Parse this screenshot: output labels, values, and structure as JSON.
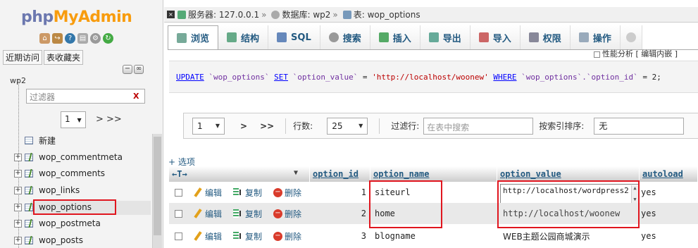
{
  "nav": {
    "logo_part1": "php",
    "logo_part2": "MyAdmin",
    "tabs": [
      "近期访问",
      "表收藏夹"
    ],
    "db_name": "wp2",
    "filter_placeholder": "过滤器",
    "page_value": "1",
    "page_arrows": "> >>",
    "new_label": "新建",
    "tables": [
      "wop_commentmeta",
      "wop_comments",
      "wop_links",
      "wop_options",
      "wop_postmeta",
      "wop_posts"
    ]
  },
  "breadcrumb": {
    "server_label": "服务器: 127.0.0.1",
    "db_label": "数据库: wp2",
    "table_label": "表: wop_options"
  },
  "tabs": [
    "浏览",
    "结构",
    "SQL",
    "搜索",
    "插入",
    "导出",
    "导入",
    "权限",
    "操作"
  ],
  "profiling_label": "性能分析 [ 编辑内嵌 ]",
  "sql": {
    "kw1": "UPDATE",
    "t1": "`wop_options`",
    "kw2": "SET",
    "t2": "`option_value`",
    "eq": " = ",
    "val": "'http://localhost/woonew'",
    "kw3": "WHERE",
    "t3": "`wop_options`.`option_id`",
    "tail": " = 2;"
  },
  "pager": {
    "page": "1",
    "next": ">",
    "last": ">>",
    "rows_label": "行数:",
    "rows_value": "25",
    "filter_label": "过滤行:",
    "filter_placeholder": "在表中搜索",
    "sort_label": "按索引排序:",
    "sort_value": "无"
  },
  "options_link": "+ 选项",
  "table": {
    "headers": [
      "option_id",
      "option_name",
      "option_value",
      "autoload"
    ],
    "actions": {
      "edit": "编辑",
      "copy": "复制",
      "delete": "删除"
    },
    "rows": [
      {
        "option_id": "1",
        "option_name": "siteurl",
        "option_value": "http://localhost/wordpress2",
        "autoload": "yes"
      },
      {
        "option_id": "2",
        "option_name": "home",
        "option_value": "http://localhost/woonew",
        "autoload": "yes"
      },
      {
        "option_id": "3",
        "option_name": "blogname",
        "option_value": "WEB主题公园商城演示",
        "autoload": "yes"
      }
    ]
  },
  "colors": {
    "link": "#235a81",
    "highlight": "#e0161f"
  }
}
